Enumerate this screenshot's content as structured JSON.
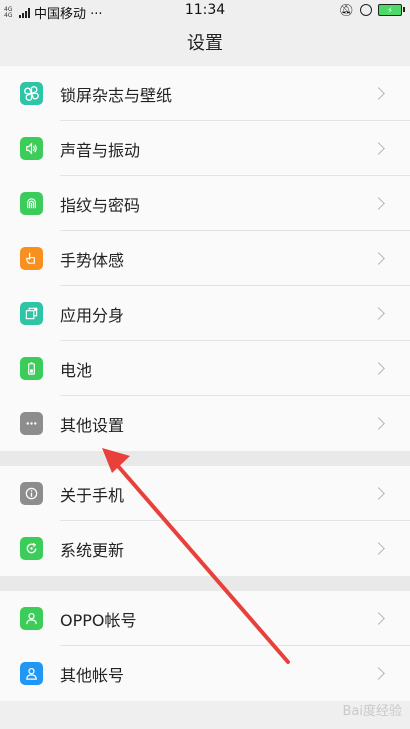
{
  "status_bar": {
    "net_top": "4G",
    "net_bottom": "4G",
    "carrier": "中国移动 ···",
    "time": "11:34"
  },
  "title": "设置",
  "groups": [
    [
      {
        "label": "锁屏杂志与壁纸",
        "icon": "pinwheel-icon",
        "color": "#2ec4a6"
      },
      {
        "label": "声音与振动",
        "icon": "speaker-icon",
        "color": "#3ccc5a"
      },
      {
        "label": "指纹与密码",
        "icon": "fingerprint-icon",
        "color": "#3ccc5a"
      },
      {
        "label": "手势体感",
        "icon": "hand-icon",
        "color": "#f7901e"
      },
      {
        "label": "应用分身",
        "icon": "app-clone-icon",
        "color": "#2ec4a6"
      },
      {
        "label": "电池",
        "icon": "battery-icon",
        "color": "#3ccc5a"
      },
      {
        "label": "其他设置",
        "icon": "more-icon",
        "color": "#8d8d8d"
      }
    ],
    [
      {
        "label": "关于手机",
        "icon": "info-icon",
        "color": "#8d8d8d"
      },
      {
        "label": "系统更新",
        "icon": "update-icon",
        "color": "#3ccc5a"
      }
    ],
    [
      {
        "label": "OPPO帐号",
        "icon": "user-icon",
        "color": "#3ccc5a"
      },
      {
        "label": "其他帐号",
        "icon": "account-icon",
        "color": "#2196f3"
      }
    ]
  ],
  "watermark": "Bai度经验"
}
